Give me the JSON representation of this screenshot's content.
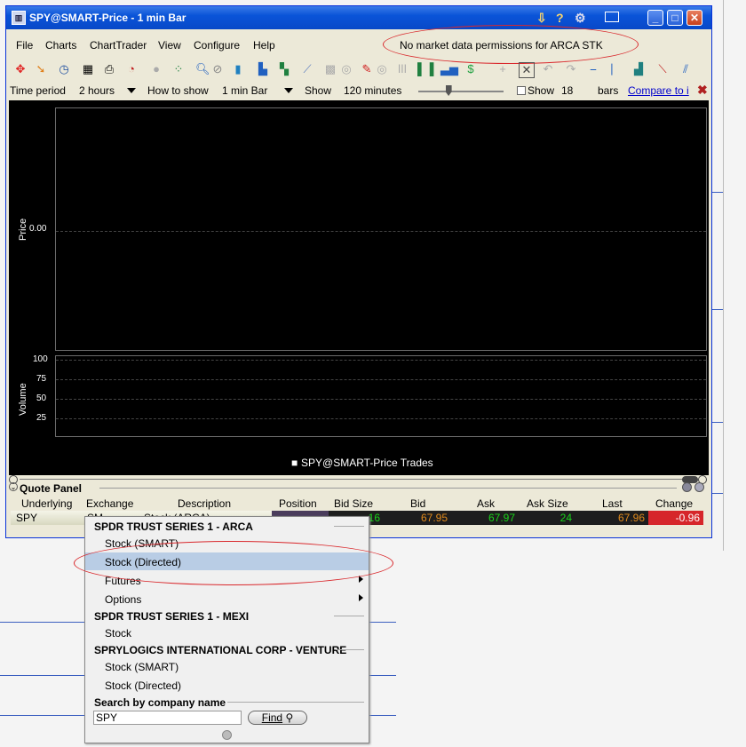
{
  "window": {
    "title": "SPY@SMART-Price - 1 min Bar",
    "help_icon": "?",
    "minimize_label": "_",
    "maximize_label": "□",
    "close_label": "✕"
  },
  "menu": {
    "items": [
      {
        "label": "File"
      },
      {
        "label": "Charts"
      },
      {
        "label": "ChartTrader"
      },
      {
        "label": "View"
      },
      {
        "label": "Configure"
      },
      {
        "label": "Help"
      }
    ],
    "message": "No market data permissions for ARCA STK"
  },
  "options": {
    "time_period_label": "Time period",
    "time_period_value": "2 hours",
    "how_to_show_label": "How to show",
    "how_to_show_value": "1 min Bar",
    "show_label": "Show",
    "show_value": "120 minutes",
    "slider_level": 0.35,
    "show_checkbox_label": "Show",
    "show_bars_value": "18",
    "bars_label": "bars",
    "compare_link": "Compare to i",
    "close_icon": "✖"
  },
  "chart": {
    "price_axis_label": "Price",
    "volume_axis_label": "Volume",
    "price_tick": "0.00",
    "volume_ticks": [
      "100",
      "75",
      "50",
      "25"
    ],
    "legend": "SPY@SMART-Price Trades"
  },
  "chart_data": {
    "type": "line",
    "series": [
      {
        "name": "SPY@SMART-Price Trades",
        "values": []
      }
    ],
    "y_price_ticks": [
      "0.00"
    ],
    "y_volume_ticks": [
      100,
      75,
      50,
      25
    ],
    "ylabel_price": "Price",
    "ylabel_volume": "Volume"
  },
  "quote_panel": {
    "title": "Quote Panel",
    "columns": [
      "Underlying",
      "Exchange",
      "Description",
      "Position",
      "Bid Size",
      "Bid",
      "Ask",
      "Ask Size",
      "Last",
      "Change"
    ],
    "row": {
      "underlying": "SPY",
      "exchange": "SM",
      "description": "Stock (ARCA)",
      "bid_size": "16",
      "bid": "67.95",
      "ask": "67.97",
      "ask_size": "24",
      "last": "67.96",
      "change": "-0.96"
    }
  },
  "popup": {
    "groups": [
      {
        "header": "SPDR TRUST SERIES 1 - ARCA",
        "items": [
          "Stock (SMART)",
          "Stock (Directed)",
          "Futures",
          "Options"
        ]
      },
      {
        "header": "SPDR TRUST SERIES 1 - MEXI",
        "items": [
          "Stock"
        ]
      },
      {
        "header": "SPRYLOGICS INTERNATIONAL CORP - VENTURE",
        "items": [
          "Stock (SMART)",
          "Stock (Directed)"
        ]
      }
    ],
    "search_label": "Search by company name",
    "search_value": "SPY",
    "find_button": "Find",
    "selected_item": "Stock (Directed)"
  },
  "colors": {
    "bid_size": "#19d419",
    "bid": "#e08a1c",
    "ask": "#19d419",
    "ask_size": "#19d419",
    "last": "#e08a1c",
    "change_bg": "#d6262a",
    "highlight_ellipse": "#d9282c"
  }
}
